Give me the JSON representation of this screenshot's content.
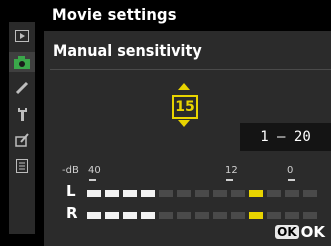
{
  "header": {
    "title": "Movie settings"
  },
  "panel": {
    "subtitle": "Manual sensitivity"
  },
  "selector": {
    "value": "15",
    "range": "1 – 20"
  },
  "meter": {
    "unit": "-dB",
    "scale": [
      "40",
      "12",
      "0"
    ],
    "channels": [
      {
        "label": "L",
        "level_segments": 4,
        "peak_segment": 9,
        "total_segments": 13
      },
      {
        "label": "R",
        "level_segments": 4,
        "peak_segment": 9,
        "total_segments": 13
      }
    ]
  },
  "footer": {
    "ok_badge": "OK",
    "ok_label": "OK"
  },
  "rail": {
    "icons": [
      "playback-menu-icon",
      "camera-icon",
      "pencil-icon",
      "wrench-icon",
      "retouch-icon",
      "my-menu-icon"
    ],
    "active_index": 1
  },
  "colors": {
    "accent": "#e8d400",
    "active_tab": "#3aa84a"
  }
}
